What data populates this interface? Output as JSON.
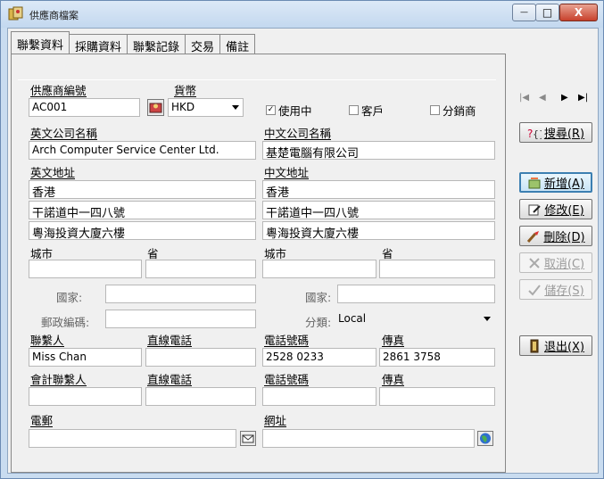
{
  "window": {
    "title": "供應商檔案",
    "minimize_symbol": "—",
    "maximize_symbol": "□",
    "close_symbol": "X"
  },
  "tabs": [
    {
      "label": "聯繫資料",
      "active": true
    },
    {
      "label": "採購資料",
      "active": false
    },
    {
      "label": "聯繫記錄",
      "active": false
    },
    {
      "label": "交易",
      "active": false
    },
    {
      "label": "備註",
      "active": false
    }
  ],
  "form": {
    "supplier_no_label": "供應商編號",
    "supplier_no": "AC001",
    "currency_label": "貨幣",
    "currency": "HKD",
    "in_use_label": "使用中",
    "in_use": true,
    "customer_label": "客戶",
    "customer": false,
    "distributor_label": "分銷商",
    "distributor": false,
    "en_company_label": "英文公司名稱",
    "en_company": "Arch Computer Service Center Ltd.",
    "cn_company_label": "中文公司名稱",
    "cn_company": "基楚電腦有限公司",
    "en_address_label": "英文地址",
    "en_address": [
      "香港",
      "干諾道中一四八號",
      "粵海投資大廈六樓"
    ],
    "cn_address_label": "中文地址",
    "cn_address": [
      "香港",
      "干諾道中一四八號",
      "粵海投資大廈六樓"
    ],
    "city_label": "城市",
    "province_label": "省",
    "city_en": "",
    "province_en": "",
    "city_cn": "",
    "province_cn": "",
    "country_label": "國家:",
    "country_en": "",
    "country_cn": "",
    "postal_label": "郵政編碼:",
    "postal": "",
    "category_label": "分類:",
    "category": "Local",
    "contact_label": "聯繫人",
    "contact": "Miss Chan",
    "direct_phone_label": "直線電話",
    "direct_phone": "",
    "phone_label": "電話號碼",
    "phone": "2528 0233",
    "fax_label": "傳真",
    "fax": "2861 3758",
    "acct_contact_label": "會計聯繫人",
    "acct_contact": "",
    "acct_direct_phone_label": "直線電話",
    "acct_direct_phone": "",
    "acct_phone_label": "電話號碼",
    "acct_phone": "",
    "acct_fax_label": "傳真",
    "acct_fax": "",
    "email_label": "電郵",
    "email": "",
    "website_label": "網址",
    "website": ""
  },
  "sidebar": {
    "nav_first": "|◀",
    "nav_prev": "◀",
    "nav_next": "▶",
    "nav_last": "▶|",
    "search_label": "搜尋(R)",
    "new_label": "新增(A)",
    "edit_label": "修改(E)",
    "delete_label": "刪除(D)",
    "cancel_label": "取消(C)",
    "save_label": "儲存(S)",
    "exit_label": "退出(X)"
  },
  "colors": {
    "focus_border": "#3c7fb1",
    "disabled_text": "#9a9a9a"
  }
}
